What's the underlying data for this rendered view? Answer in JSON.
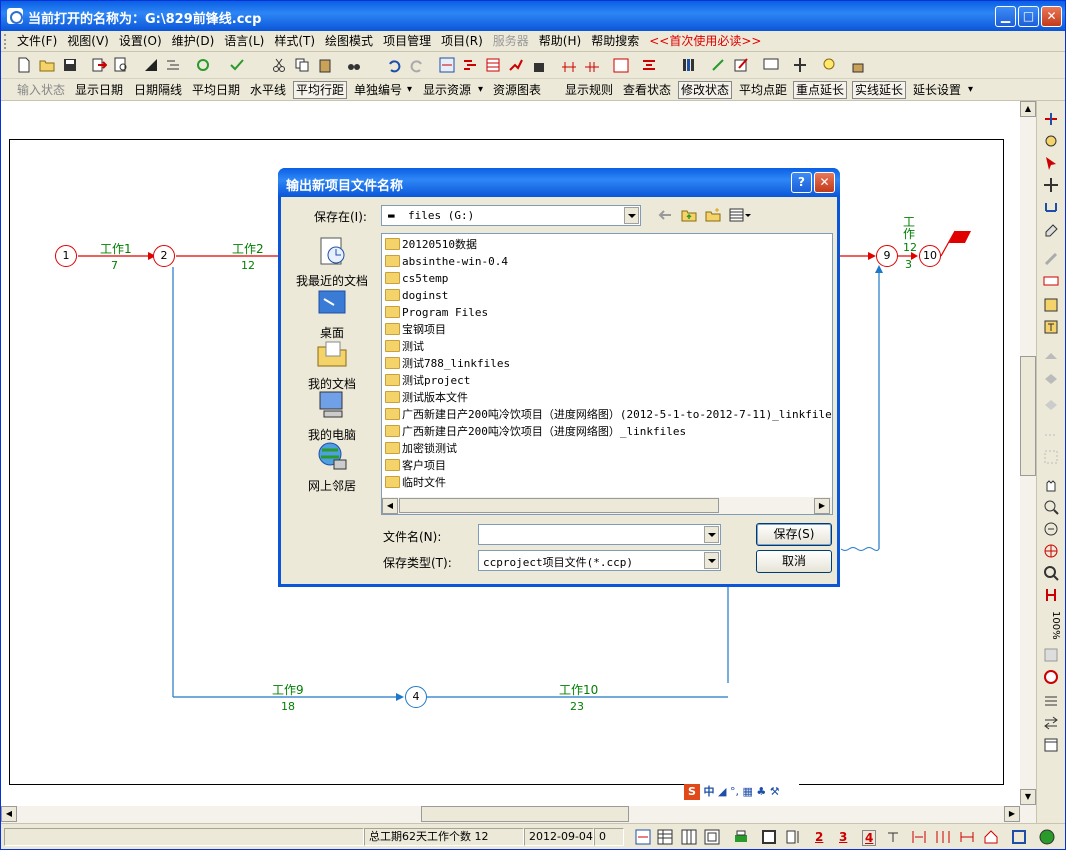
{
  "window": {
    "title": "当前打开的名称为：G:\\829前锋线.ccp",
    "min_glyph": "▁",
    "max_glyph": "□",
    "close_glyph": "✕"
  },
  "menu": [
    {
      "label": "文件(F)",
      "state": "normal"
    },
    {
      "label": "视图(V)",
      "state": "normal"
    },
    {
      "label": "设置(O)",
      "state": "normal"
    },
    {
      "label": "维护(D)",
      "state": "normal"
    },
    {
      "label": "语言(L)",
      "state": "normal"
    },
    {
      "label": "样式(T)",
      "state": "normal"
    },
    {
      "label": "绘图模式",
      "state": "normal"
    },
    {
      "label": "项目管理",
      "state": "normal"
    },
    {
      "label": "项目(R)",
      "state": "normal"
    },
    {
      "label": "服务器",
      "state": "disabled"
    },
    {
      "label": "帮助(H)",
      "state": "normal"
    },
    {
      "label": "帮助搜索",
      "state": "normal"
    },
    {
      "label": "<<首次使用必读>>",
      "state": "highlight"
    }
  ],
  "toolbar2": {
    "input_state": "输入状态",
    "show_date": "显示日期",
    "date_interval": "日期隔线",
    "avg_date": "平均日期",
    "horizontal": "水平线",
    "avg_row_spacing": "平均行距",
    "single_numbering": "单独编号",
    "dropdown_glyph": "▾",
    "show_resources": "显示资源",
    "resource_chart": "资源图表",
    "show_rules": "显示规则",
    "view_state": "查看状态",
    "edit_state": "修改状态",
    "avg_point_spacing": "平均点距",
    "key_extend": "重点延长",
    "solid_extend": "实线延长",
    "extend_settings": "延长设置"
  },
  "network": {
    "nodes": [
      "1",
      "2",
      "4",
      "9",
      "10"
    ],
    "tasks": [
      {
        "name": "工作1",
        "duration": "7"
      },
      {
        "name": "工作2",
        "duration": "12"
      },
      {
        "name": "工作9",
        "duration": "18"
      },
      {
        "name": "工作10",
        "duration": "23"
      },
      {
        "name": "工作",
        "duration": "12",
        "extra": "3"
      }
    ]
  },
  "dialog": {
    "title": "输出新项目文件名称",
    "help_glyph": "?",
    "close_glyph": "✕",
    "save_in_label": "保存在(I):",
    "save_in_value": "files (G:)",
    "places": [
      "我最近的文档",
      "桌面",
      "我的文档",
      "我的电脑",
      "网上邻居"
    ],
    "files": [
      "20120510数据",
      "absinthe-win-0.4",
      "cs5temp",
      "doginst",
      "Program Files",
      "宝钢项目",
      "测试",
      "测试788_linkfiles",
      "测试project",
      "测试版本文件",
      "广西新建日产200吨冷饮项目（进度网络图）(2012-5-1-to-2012-7-11)_linkfiles",
      "广西新建日产200吨冷饮项目（进度网络图）_linkfiles",
      "加密锁测试",
      "客户项目",
      "临时文件"
    ],
    "filename_label": "文件名(N):",
    "filename_value": "",
    "filetype_label": "保存类型(T):",
    "filetype_value": "ccproject项目文件(*.ccp)",
    "save_button": "保存(S)",
    "cancel_button": "取消"
  },
  "ime": {
    "brand": "S",
    "mode": "中",
    "symbols": "◢ °, ▦ ♣ ⚒"
  },
  "statusbar": {
    "summary": "总工期62天工作个数 12",
    "date": "2012-09-04",
    "value": "0",
    "b1": "2",
    "b2": "3",
    "b3": "4"
  },
  "right_zoom": "100%",
  "colors": {
    "critical": "#E00000",
    "normal": "#1E78C8",
    "label": "#008000",
    "titlebar": "#0A5FE4"
  }
}
